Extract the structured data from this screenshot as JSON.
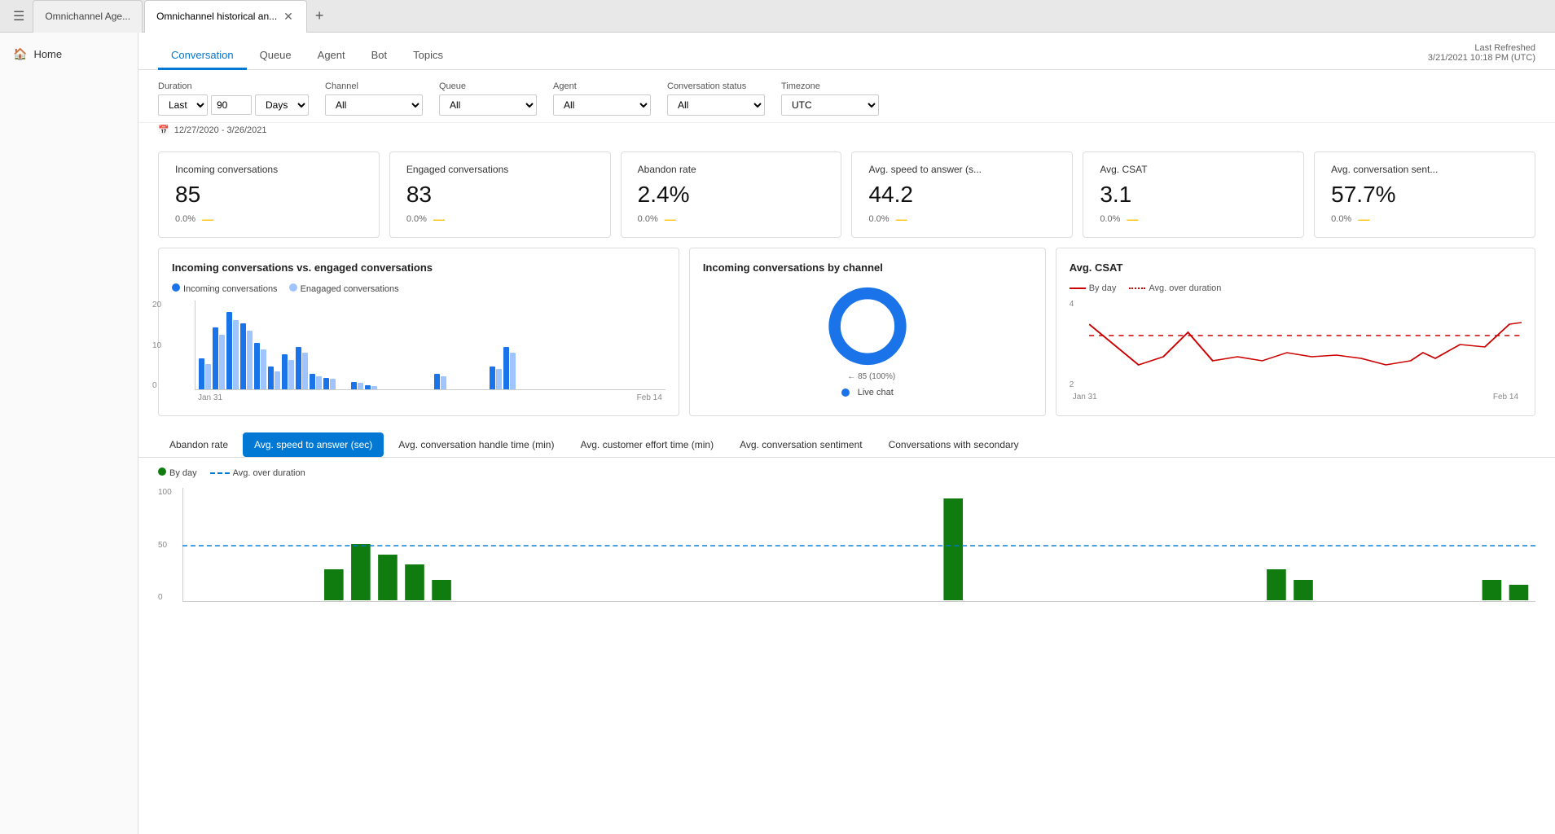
{
  "tabs": [
    {
      "id": "tab1",
      "label": "Omnichannel Age...",
      "active": false,
      "closeable": false
    },
    {
      "id": "tab2",
      "label": "Omnichannel historical an...",
      "active": true,
      "closeable": true
    }
  ],
  "sidebar": {
    "items": [
      {
        "id": "home",
        "icon": "🏠",
        "label": "Home"
      }
    ]
  },
  "header": {
    "last_refreshed_label": "Last Refreshed",
    "last_refreshed_value": "3/21/2021 10:18 PM (UTC)"
  },
  "nav_tabs": [
    {
      "id": "conversation",
      "label": "Conversation",
      "active": true
    },
    {
      "id": "queue",
      "label": "Queue",
      "active": false
    },
    {
      "id": "agent",
      "label": "Agent",
      "active": false
    },
    {
      "id": "bot",
      "label": "Bot",
      "active": false
    },
    {
      "id": "topics",
      "label": "Topics",
      "active": false
    }
  ],
  "filters": {
    "duration_label": "Duration",
    "duration_option": "Last",
    "duration_value": "90",
    "duration_unit": "Days",
    "channel_label": "Channel",
    "channel_value": "All",
    "queue_label": "Queue",
    "queue_value": "All",
    "agent_label": "Agent",
    "agent_value": "All",
    "conv_status_label": "Conversation status",
    "conv_status_value": "All",
    "timezone_label": "Timezone",
    "timezone_value": "UTC",
    "date_range": "12/27/2020 - 3/26/2021"
  },
  "kpis": [
    {
      "title": "Incoming conversations",
      "value": "85",
      "change": "0.0%",
      "dash": "—"
    },
    {
      "title": "Engaged conversations",
      "value": "83",
      "change": "0.0%",
      "dash": "—"
    },
    {
      "title": "Abandon rate",
      "value": "2.4%",
      "change": "0.0%",
      "dash": "—"
    },
    {
      "title": "Avg. speed to answer (s...",
      "value": "44.2",
      "change": "0.0%",
      "dash": "—"
    },
    {
      "title": "Avg. CSAT",
      "value": "3.1",
      "change": "0.0%",
      "dash": "—"
    },
    {
      "title": "Avg. conversation sent...",
      "value": "57.7%",
      "change": "0.0%",
      "dash": "—"
    }
  ],
  "charts": {
    "bar_chart": {
      "title": "Incoming conversations vs. engaged conversations",
      "legend_incoming": "Incoming conversations",
      "legend_engaged": "Enagaged conversations",
      "x_label1": "Jan 31",
      "x_label2": "Feb 14",
      "y_max": "20",
      "y_mid": "10",
      "y_min": "0",
      "bars": [
        {
          "incoming": 40,
          "engaged": 35
        },
        {
          "incoming": 80,
          "engaged": 75
        },
        {
          "incoming": 100,
          "engaged": 95
        },
        {
          "incoming": 85,
          "engaged": 80
        },
        {
          "incoming": 60,
          "engaged": 55
        },
        {
          "incoming": 30,
          "engaged": 25
        },
        {
          "incoming": 45,
          "engaged": 40
        },
        {
          "incoming": 55,
          "engaged": 50
        },
        {
          "incoming": 20,
          "engaged": 18
        },
        {
          "incoming": 15,
          "engaged": 14
        },
        {
          "incoming": 0,
          "engaged": 0
        },
        {
          "incoming": 10,
          "engaged": 9
        },
        {
          "incoming": 5,
          "engaged": 4
        },
        {
          "incoming": 0,
          "engaged": 0
        },
        {
          "incoming": 0,
          "engaged": 0
        },
        {
          "incoming": 0,
          "engaged": 0
        },
        {
          "incoming": 0,
          "engaged": 0
        },
        {
          "incoming": 20,
          "engaged": 18
        },
        {
          "incoming": 0,
          "engaged": 0
        },
        {
          "incoming": 0,
          "engaged": 0
        },
        {
          "incoming": 0,
          "engaged": 0
        },
        {
          "incoming": 30,
          "engaged": 28
        },
        {
          "incoming": 55,
          "engaged": 50
        },
        {
          "incoming": 0,
          "engaged": 0
        }
      ]
    },
    "donut_chart": {
      "title": "Incoming conversations by channel",
      "legend_label": "Live chat",
      "label_value": "85 (100%)"
    },
    "line_chart": {
      "title": "Avg. CSAT",
      "legend_by_day": "By day",
      "legend_avg": "Avg. over duration",
      "x_label1": "Jan 31",
      "x_label2": "Feb 14",
      "y_max": "4",
      "y_min": "2"
    }
  },
  "bottom_tabs": [
    {
      "label": "Abandon rate",
      "active": false
    },
    {
      "label": "Avg. speed to answer (sec)",
      "active": true
    },
    {
      "label": "Avg. conversation handle time (min)",
      "active": false
    },
    {
      "label": "Avg. customer effort time (min)",
      "active": false
    },
    {
      "label": "Avg. conversation sentiment",
      "active": false
    },
    {
      "label": "Conversations with secondary",
      "active": false
    }
  ],
  "bottom_chart": {
    "legend_by_day": "By day",
    "legend_avg": "Avg. over duration",
    "y_labels": [
      "100",
      "50",
      "0"
    ],
    "bars": [
      0,
      0,
      0,
      0,
      0,
      30,
      55,
      45,
      35,
      20,
      0,
      0,
      0,
      0,
      0,
      0,
      0,
      0,
      0,
      0,
      0,
      0,
      0,
      0,
      0,
      0,
      0,
      0,
      100,
      0,
      0,
      0,
      0,
      0,
      0,
      0,
      0,
      0,
      0,
      0,
      30,
      20,
      0,
      0,
      0,
      0,
      0,
      0,
      20,
      15
    ]
  }
}
